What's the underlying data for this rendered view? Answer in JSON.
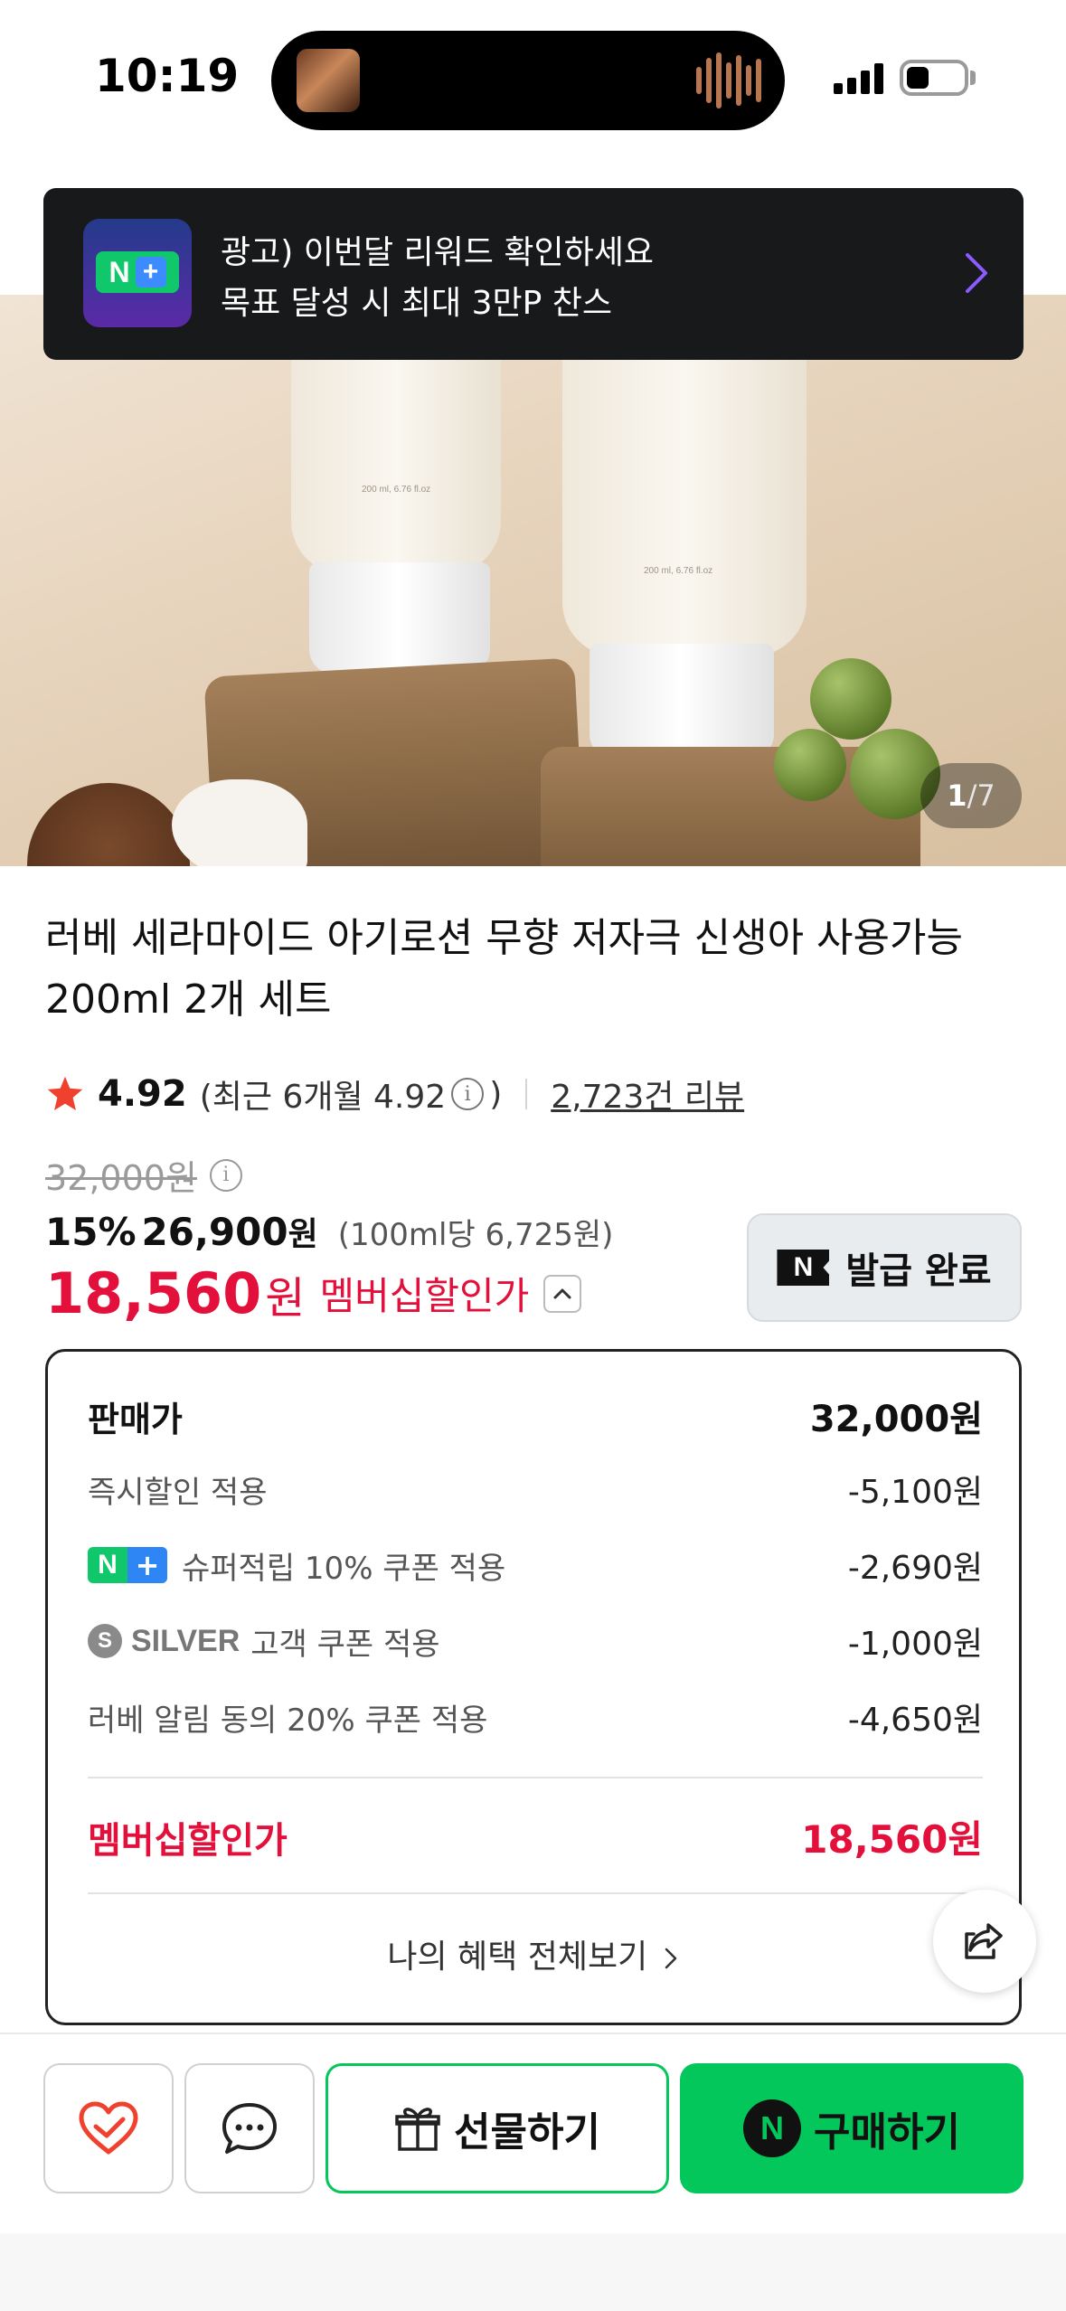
{
  "status_bar": {
    "time": "10:19"
  },
  "ad_banner": {
    "line1": "광고) 이번달 리워드 확인하세요",
    "line2": "목표 달성 시 최대 3만P 찬스",
    "logo_icon": "naver-plus-logo-icon",
    "logo_text": "N"
  },
  "gallery": {
    "current": "1",
    "separator": "/",
    "total": "7",
    "tube_label": "200 ml, 6.76 fl.oz"
  },
  "product": {
    "title": "러베 세라마이드 아기로션 무향 저자극 신생아 사용가능 200ml 2개 세트",
    "rating": "4.92",
    "recent_open": "(최근 6개월 4.92",
    "recent_close": ")",
    "reviews": "2,723건 리뷰",
    "original_price": "32,000원",
    "discount_percent": "15%",
    "sale_price": "26,900",
    "sale_won": "원",
    "unit_price": "(100ml당 6,725원)",
    "member_price": "18,560",
    "member_won": "원",
    "member_label": "멤버십할인가"
  },
  "coupon_button": {
    "label": "발급 완료",
    "icon": "N"
  },
  "breakdown": {
    "header_label": "판매가",
    "header_value": "32,000원",
    "rows": [
      {
        "label": "즉시할인 적용",
        "value": "-5,100원"
      },
      {
        "label": "슈퍼적립 10% 쿠폰 적용",
        "value": "-2,690원",
        "badge_n": "N",
        "badge_p": "+"
      },
      {
        "label": "고객 쿠폰 적용",
        "value": "-1,000원",
        "silver_icon": "S",
        "silver_text": "SILVER"
      },
      {
        "label": "러베 알림 동의 20% 쿠폰 적용",
        "value": "-4,650원"
      }
    ],
    "member_label": "멤버십할인가",
    "member_value": "18,560원",
    "more_label": "나의 혜택 전체보기"
  },
  "bottom_bar": {
    "gift_label": "선물하기",
    "buy_label": "구매하기",
    "buy_icon": "N"
  },
  "colors": {
    "accent_red": "#e4103c",
    "naver_green": "#03c75a",
    "star_red": "#f0412e"
  }
}
